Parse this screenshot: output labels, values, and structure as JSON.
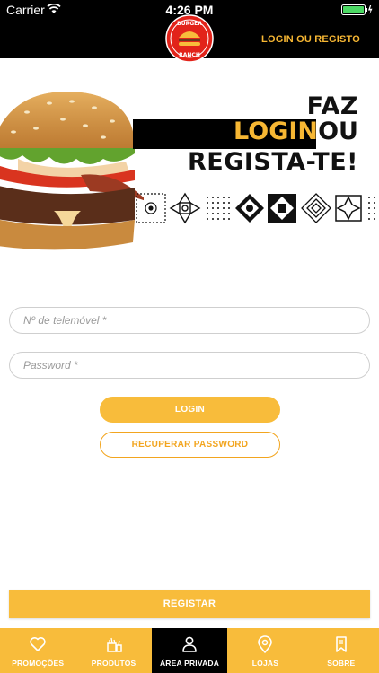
{
  "status_bar": {
    "carrier": "Carrier",
    "time": "4:26 PM",
    "battery_color": "#4cd964"
  },
  "header": {
    "brand": "BURGER RANCH",
    "login_link": "LOGIN OU REGISTO"
  },
  "hero": {
    "slogan_line1": "FAZ",
    "slogan_highlight": "LOGIN",
    "slogan_line2_rest": "OU",
    "slogan_line3": "REGISTA-TE!"
  },
  "form": {
    "phone_placeholder": "Nº de telemóvel *",
    "password_placeholder": "Password *",
    "login_label": "LOGIN",
    "recover_label": "RECUPERAR PASSWORD"
  },
  "register_label": "REGISTAR",
  "nav": {
    "items": [
      {
        "label": "PROMOÇÕES",
        "icon": "heart-icon",
        "active": false
      },
      {
        "label": "PRODUTOS",
        "icon": "food-icon",
        "active": false
      },
      {
        "label": "ÁREA PRIVADA",
        "icon": "user-icon",
        "active": true
      },
      {
        "label": "LOJAS",
        "icon": "map-pin-icon",
        "active": false
      },
      {
        "label": "SOBRE",
        "icon": "bookmark-icon",
        "active": false
      }
    ]
  },
  "colors": {
    "accent": "#f8bc3b",
    "dark": "#000000"
  }
}
